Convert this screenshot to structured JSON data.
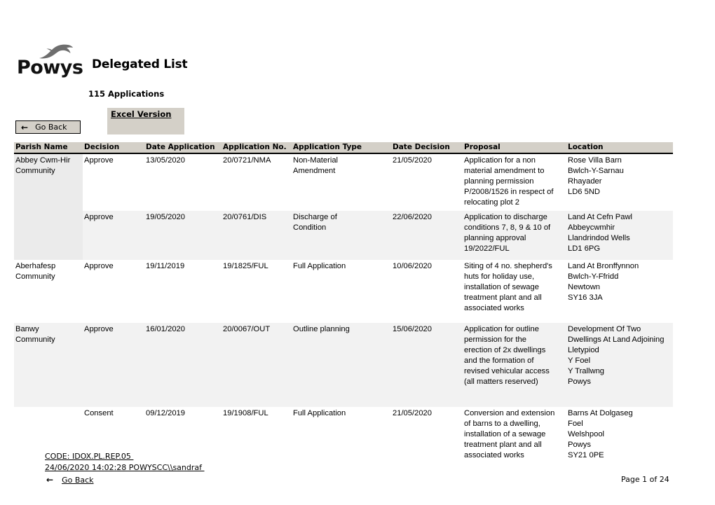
{
  "logo": {
    "word": "Powys",
    "bird_icon": "red-kite-bird-icon"
  },
  "header": {
    "title": "Delegated List",
    "application_count": "115 Applications"
  },
  "toolbar": {
    "excel_link": "Excel Version",
    "go_back_label": "Go Back",
    "back_arrow": "←"
  },
  "table": {
    "columns": [
      "Parish Name",
      "Decision",
      "Date Application",
      "Application No.",
      "Application Type",
      "Date Decision",
      "Proposal",
      "Location"
    ],
    "rows": [
      {
        "parish": "Abbey Cwm-Hir\nCommunity",
        "parish_shaded": true,
        "decision": "Approve",
        "date_application": "13/05/2020",
        "application_no": "20/0721/NMA",
        "application_type": "Non-Material\nAmendment",
        "date_decision": "21/05/2020",
        "proposal": "Application for a non\nmaterial amendment to\nplanning permission\nP/2008/1526 in respect of\nrelocating plot 2",
        "location": "Rose Villa Barn\nBwlch-Y-Sarnau\nRhayader\nLD6 5ND",
        "shaded": false
      },
      {
        "parish": "",
        "parish_shaded": true,
        "decision": "Approve",
        "date_application": "19/05/2020",
        "application_no": "20/0761/DIS",
        "application_type": "Discharge of\nCondition",
        "date_decision": "22/06/2020",
        "proposal": "Application to discharge\nconditions 7, 8, 9 & 10 of\nplanning approval\n19/2022/FUL",
        "location": "Land At Cefn Pawl\nAbbeycwmhir\nLlandrindod Wells\nLD1 6PG",
        "shaded": true
      },
      {
        "parish": "Aberhafesp\nCommunity",
        "parish_shaded": false,
        "decision": "Approve",
        "date_application": "19/11/2019",
        "application_no": "19/1825/FUL",
        "application_type": "Full Application",
        "date_decision": "10/06/2020",
        "proposal": "Siting of 4 no. shepherd's\nhuts for holiday use,\ninstallation of sewage\ntreatment plant and all\nassociated works",
        "location": "Land At Bronffynnon\nBwlch-Y-Ffridd\nNewtown\nSY16 3JA",
        "shaded": false
      },
      {
        "parish": "Banwy\nCommunity",
        "parish_shaded": false,
        "decision": "Approve",
        "date_application": "16/01/2020",
        "application_no": "20/0067/OUT",
        "application_type": "Outline planning",
        "date_decision": "15/06/2020",
        "proposal": "Application for outline\npermission for the\nerection of 2x dwellings\nand the formation of\nrevised vehicular access\n(all matters reserved)",
        "location": "Development Of Two\nDwellings At Land Adjoining\nLletypiod\nY Foel\nY Trallwng\nPowys",
        "shaded": true
      },
      {
        "parish": "",
        "parish_shaded": false,
        "decision": "Consent",
        "date_application": "09/12/2019",
        "application_no": "19/1908/FUL",
        "application_type": "Full Application",
        "date_decision": "21/05/2020",
        "proposal": "Conversion and extension\nof barns to a dwelling,\ninstallation of a sewage\ntreatment plant and all\nassociated works",
        "location": "Barns At Dolgaseg\nFoel\nWelshpool\nPowys\nSY21 0PE",
        "shaded": false
      }
    ]
  },
  "footer": {
    "code_line": "CODE: IDOX.PL.REP.05 ",
    "timestamp_line": "24/06/2020 14:02:28 POWYSCC\\\\sandraf ",
    "go_back_label": "Go Back",
    "back_arrow": "←",
    "page_number": "Page 1 of 24"
  },
  "colors": {
    "header_fill": "#d4d0c8",
    "row_shade": "#f2f2f2",
    "parish_group_shade": "#ebebeb",
    "text": "#000000"
  }
}
